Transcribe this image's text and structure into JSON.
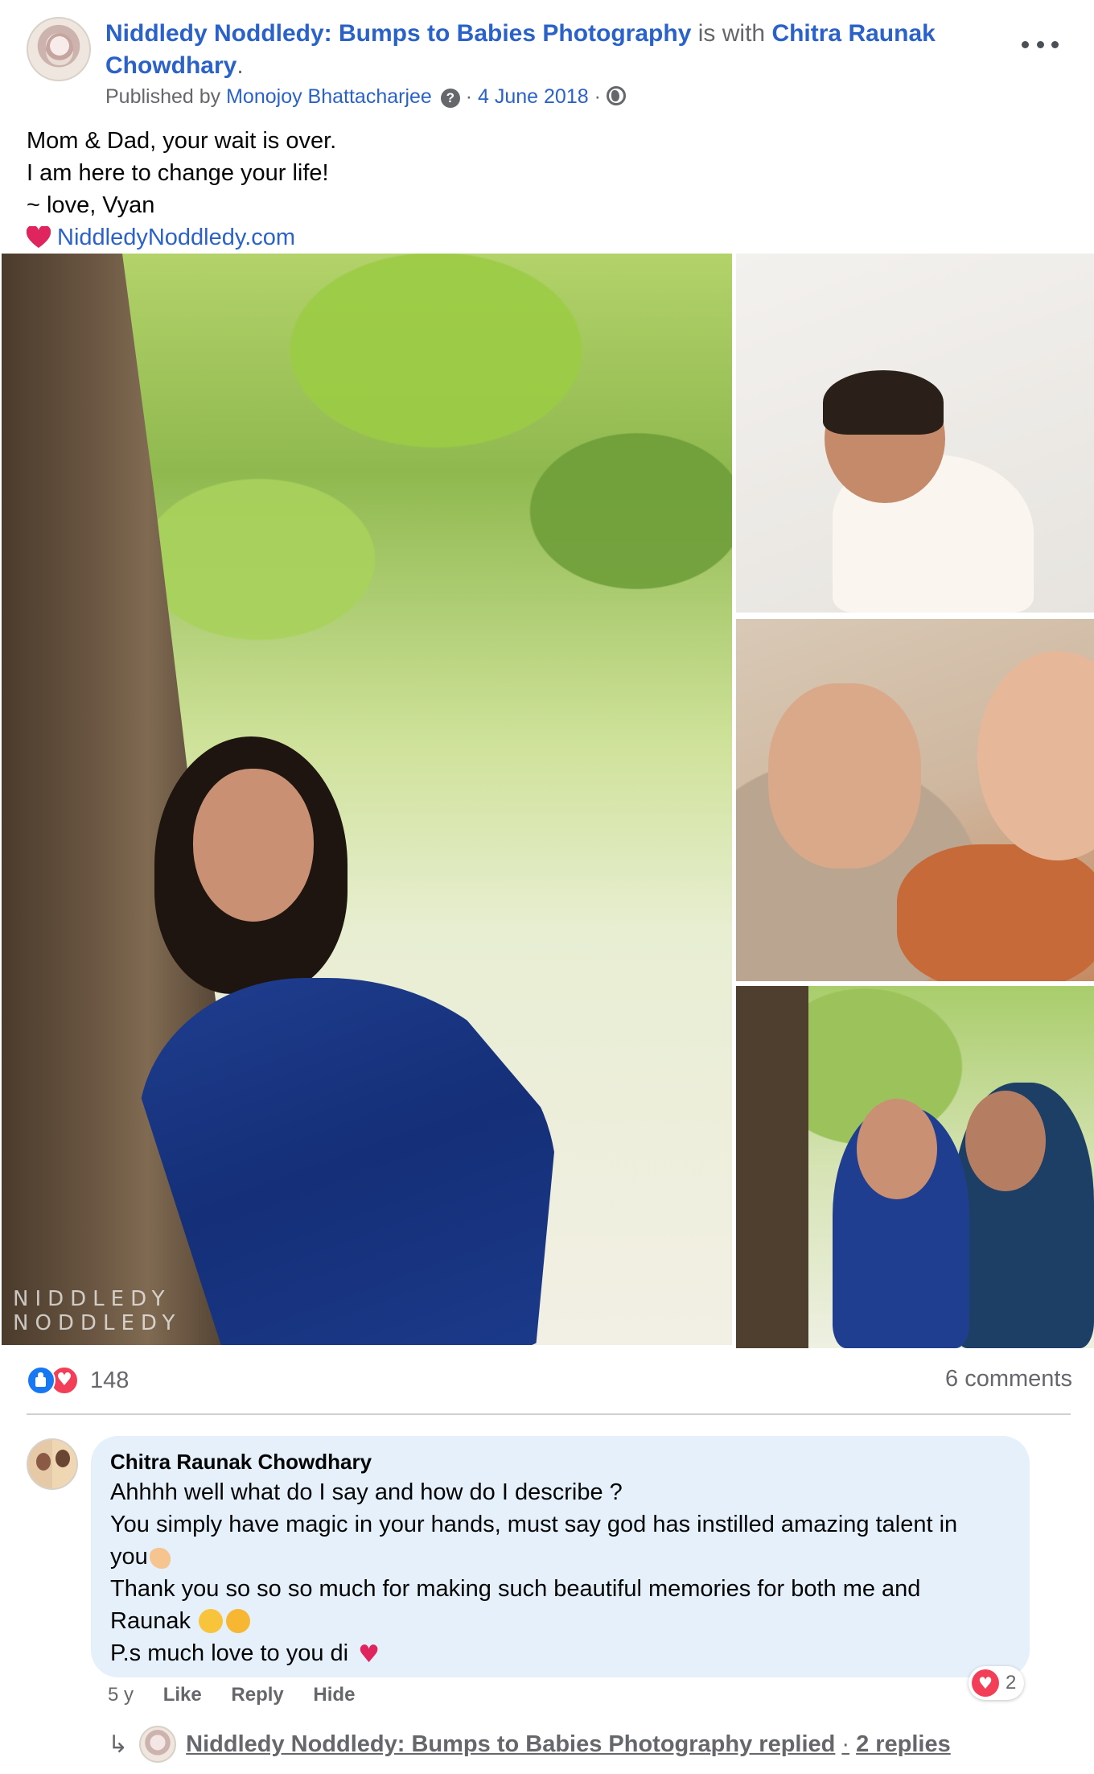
{
  "header": {
    "page_name": "Niddledy Noddledy: Bumps to Babies Photography",
    "with_text": "is with",
    "tagged_name": "Chitra Raunak Chowdhary",
    "period": ".",
    "published_by": "Published by",
    "publisher": "Monojoy Bhattacharjee",
    "help_glyph": "?",
    "sep1": " · ",
    "date": "4 June 2018",
    "sep2": " · ",
    "privacy_icon": "globe-icon",
    "more_icon": "more-dots-icon"
  },
  "post": {
    "lines": [
      "Mom & Dad, your wait is over.",
      "I am here to change your life!",
      "~ love, Vyan"
    ],
    "website": "NiddledyNoddledy.com"
  },
  "photos": {
    "watermark_line1": "NIDDLEDY",
    "watermark_line2": "NODDLEDY"
  },
  "reactions": {
    "icons": [
      "like-icon",
      "love-icon"
    ],
    "count": "148",
    "comments": "6 comments"
  },
  "comment": {
    "author": "Chitra Raunak Chowdhary",
    "lines": [
      "Ahhhh well what do I say and how do I describe ?",
      "You simply have magic in your hands, must say god has instilled amazing talent in",
      "you",
      "Thank you so so so much for making such beautiful memories for both me and",
      "Raunak",
      "P.s much love to you di"
    ],
    "heart_glyph": "♥",
    "reaction_count": "2",
    "time": "5 y",
    "like": "Like",
    "reply": "Reply",
    "hide": "Hide"
  },
  "reply_row": {
    "arrow": "↳",
    "replier": "Niddledy Noddledy: Bumps to Babies Photography replied",
    "sep": "·",
    "count": "2 replies"
  },
  "colors": {
    "link": "#2a62c9",
    "muted": "#65676b",
    "bubble": "#e5f0fb",
    "like_blue": "#1877f2",
    "love_red": "#f33e58"
  }
}
